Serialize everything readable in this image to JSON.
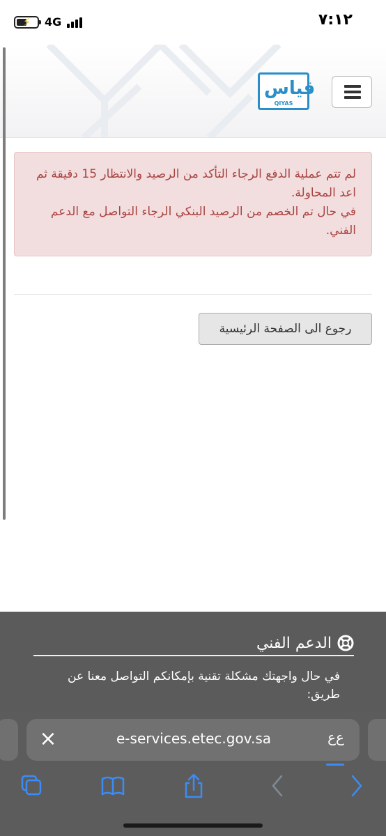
{
  "status_bar": {
    "time": "٧:١٢",
    "network": "4G"
  },
  "header": {
    "logo_text": "QIYAS",
    "logo_mark": "قياس",
    "brand_color": "#2a8fc7"
  },
  "alert": {
    "line1": "لم تتم عملية الدفع الرجاء التأكد من الرصيد والانتظار 15 دقيقة ثم اعد المحاولة.",
    "line2": "في حال تم الخصم من الرصيد البنكي الرجاء التواصل مع الدعم الفني.",
    "background": "#f2dede",
    "text_color": "#a94442"
  },
  "home_button": {
    "label": "رجوع الى الصفحة الرئيسية"
  },
  "footer": {
    "support_title": "الدعم الفني",
    "support_text": "في حال واجهتك مشكلة تقنية بإمكانكم التواصل معنا عن طريق:"
  },
  "browser": {
    "url": "e-services.etec.gov.sa",
    "reader_label": "ع‌ع",
    "close_icon": "close-icon",
    "accent": "#3b8cf6",
    "toolbar_icons": [
      "tabs-icon",
      "bookmarks-icon",
      "share-icon",
      "back-icon",
      "forward-icon"
    ]
  }
}
